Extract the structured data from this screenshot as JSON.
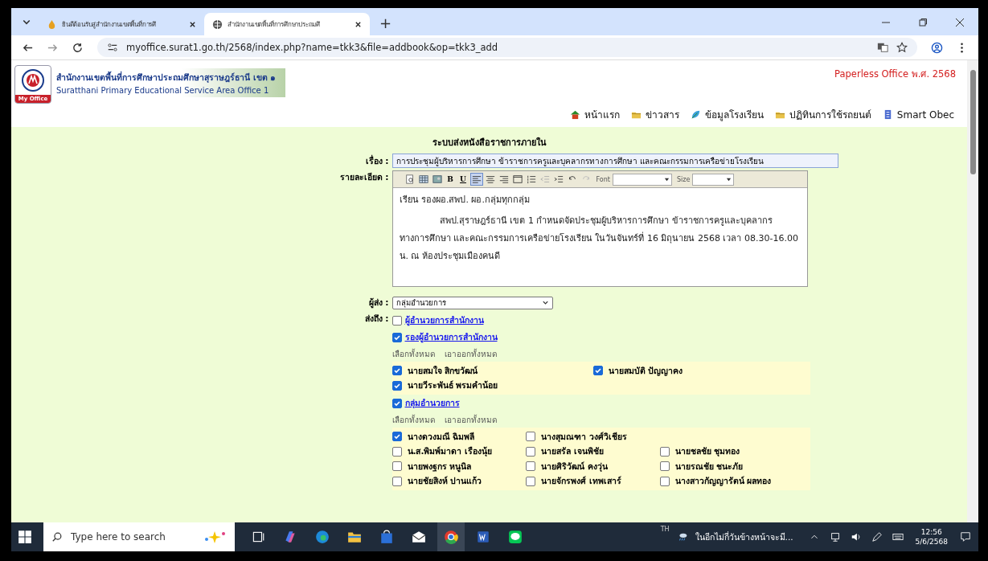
{
  "browser": {
    "tabs": [
      {
        "title": "ยินดีต้อนรับสู่สำนักงานเขตพื้นที่การศึ",
        "selected": false
      },
      {
        "title": "สำนักงานเขตพื้นที่การศึกษาประถมศึ",
        "selected": true
      }
    ],
    "new_tab": "+",
    "url": "myoffice.surat1.go.th/2568/index.php?name=tkk3&file=addbook&op=tkk3_add"
  },
  "site": {
    "logo_text": "My Office",
    "title_th": "สำนักงานเขตพื้นที่การศึกษาประถมศึกษาสุราษฎร์ธานี เขต ๑",
    "title_en": "Suratthani Primary Educational Service Area Office 1",
    "tagline": "Paperless Office พ.ศ. 2568",
    "nav": [
      {
        "label": "หน้าแรก",
        "kind": "home"
      },
      {
        "label": "ข่าวสาร",
        "kind": "folder"
      },
      {
        "label": "ข้อมูลโรงเรียน",
        "kind": "leaf"
      },
      {
        "label": "ปฏิทินการใช้รถยนต์",
        "kind": "folder"
      },
      {
        "label": "Smart Obec",
        "kind": "doc"
      }
    ]
  },
  "form": {
    "heading": "ระบบส่งหนังสือราชการภายใน",
    "subject_label": "เรื่อง :",
    "subject": "การประชุมผู้บริหารการศึกษา ข้าราชการครูและบุคลากรทางการศึกษา และคณะกรรมการเครือข่ายโรงเรียน",
    "detail_label": "รายละเอียด :",
    "editor": {
      "bold": "B",
      "underline": "U",
      "font_label": "Font",
      "size_label": "Size",
      "greeting": "เรียน รองผอ.สพป.  ผอ.กลุ่มทุกกลุ่ม",
      "body": "สพป.สุราษฎร์ธานี เขต 1 กำหนดจัดประชุมผู้บริหารการศึกษา ข้าราชการครูและบุคลากรทางการศึกษา และคณะกรรมการเครือข่ายโรงเรียน ในวันจันทร์ที่ 16 มิถุนายน 2568 เวลา 08.30-16.00 น. ณ ห้องประชุมเมืองคนดี"
    },
    "sender_label": "ผู้ส่ง :",
    "sender": "กลุ่มอำนวยการ",
    "recipients_label": "ส่งถึง :",
    "groups": [
      {
        "name": "ผู้อำนวยการสำนักงาน",
        "checked": false
      },
      {
        "name": "รองผู้อำนวยการสำนักงาน",
        "checked": true,
        "select_all": "เลือกทั้งหมด",
        "deselect_all": "เอาออกทั้งหมด",
        "rows": [
          [
            {
              "name": "นายสมใจ สิกขวัฒน์",
              "checked": true
            },
            {
              "name": "นายสมบัติ ปัญญาคง",
              "checked": true
            }
          ],
          [
            {
              "name": "นายวีระพันธ์ พรมคำน้อย",
              "checked": true
            }
          ]
        ]
      },
      {
        "name": "กลุ่มอำนวยการ",
        "checked": true,
        "select_all": "เลือกทั้งหมด",
        "deselect_all": "เอาออกทั้งหมด",
        "rows": [
          [
            {
              "name": "นางดวงมณี ฉิมพลี",
              "checked": true
            },
            {
              "name": "นางสุมณฑา วงศ์วิเชียร",
              "checked": false
            }
          ],
          [
            {
              "name": "น.ส.พิมพ์มาดา เรืองนุ้ย",
              "checked": false
            },
            {
              "name": "นายสรัล เจนพิชัย",
              "checked": false
            },
            {
              "name": "นายชลชัย ชุมทอง",
              "checked": false
            }
          ],
          [
            {
              "name": "นายพงฐกร หนูนิล",
              "checked": false
            },
            {
              "name": "นายศิริวัฒน์ คงวุ่น",
              "checked": false
            },
            {
              "name": "นายรณชัย ชนะภัย",
              "checked": false
            }
          ],
          [
            {
              "name": "นายชัยสิงห์ ปานแก้ว",
              "checked": false
            },
            {
              "name": "นายจักรพงศ์ เทพเสาร์",
              "checked": false
            },
            {
              "name": "นางสาวกัญญารัตน์ ผลทอง",
              "checked": false
            }
          ]
        ]
      }
    ]
  },
  "taskbar": {
    "search_placeholder": "Type here to search",
    "language": "TH",
    "weather": "ในอีกไม่กี่วันข้างหน้าจะมี...",
    "time": "12:56",
    "date": "5/6/2568"
  }
}
